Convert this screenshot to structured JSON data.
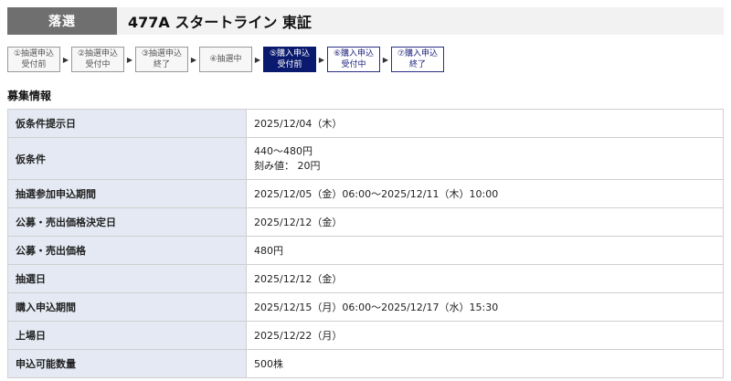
{
  "header": {
    "status": "落選",
    "title": "477A スタートライン 東証"
  },
  "steps": [
    {
      "line1": "①抽選申込",
      "line2": "受付前"
    },
    {
      "line1": "②抽選申込",
      "line2": "受付中"
    },
    {
      "line1": "③抽選申込",
      "line2": "終了"
    },
    {
      "line1": "④抽選中",
      "line2": ""
    },
    {
      "line1": "⑤購入申込",
      "line2": "受付前"
    },
    {
      "line1": "⑥購入申込",
      "line2": "受付中"
    },
    {
      "line1": "⑦購入申込",
      "line2": "終了"
    }
  ],
  "arrow": "▶",
  "section_title": "募集情報",
  "rows": [
    {
      "label": "仮条件提示日",
      "value": "2025/12/04（木）"
    },
    {
      "label": "仮条件",
      "value": "440～480円",
      "value2": "刻み値： 20円"
    },
    {
      "label": "抽選参加申込期間",
      "value": "2025/12/05（金）06:00～2025/12/11（木）10:00"
    },
    {
      "label": "公募・売出価格決定日",
      "value": "2025/12/12（金）"
    },
    {
      "label": "公募・売出価格",
      "value": "480円"
    },
    {
      "label": "抽選日",
      "value": "2025/12/12（金）"
    },
    {
      "label": "購入申込期間",
      "value": "2025/12/15（月）06:00～2025/12/17（水）15:30"
    },
    {
      "label": "上場日",
      "value": "2025/12/22（月）"
    },
    {
      "label": "申込可能数量",
      "value": "500株"
    }
  ]
}
